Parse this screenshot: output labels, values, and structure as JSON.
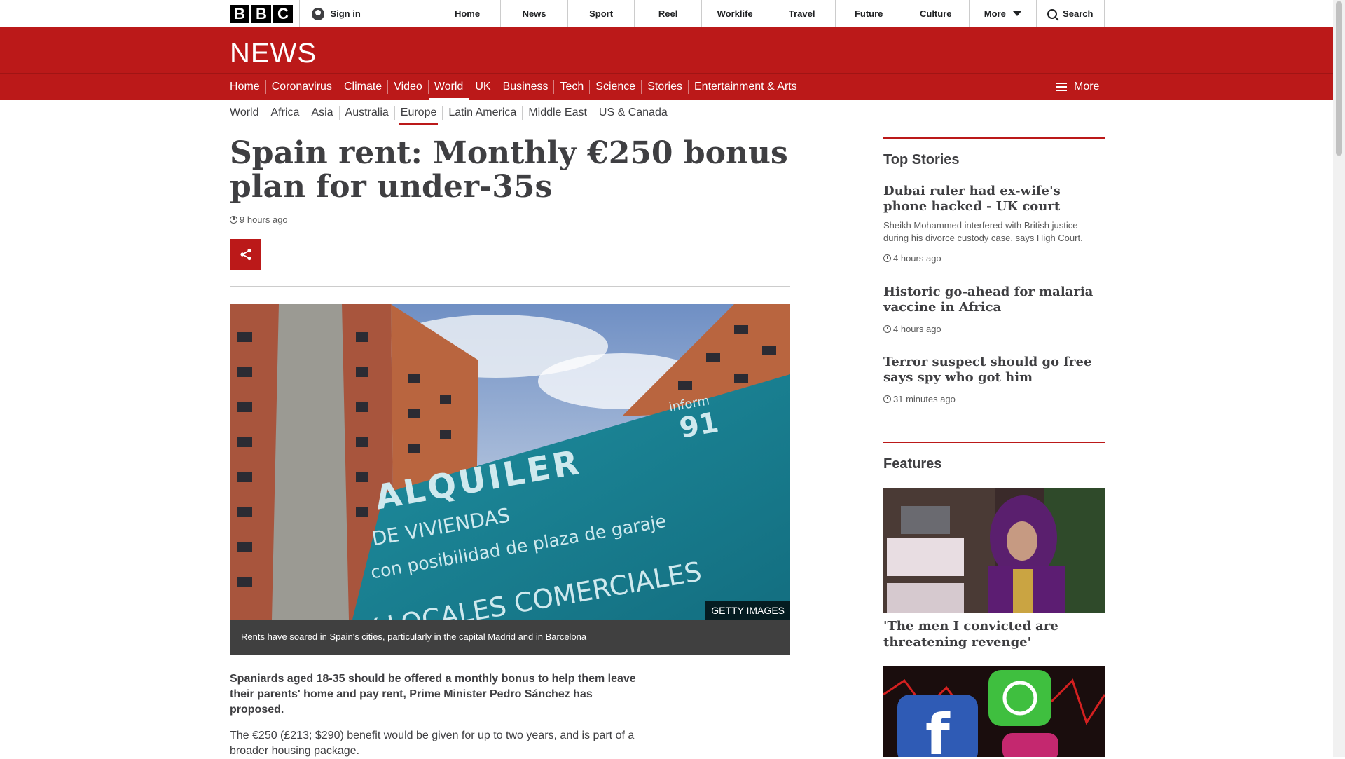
{
  "global_nav": {
    "logo": [
      "B",
      "B",
      "C"
    ],
    "sign_in": "Sign in",
    "items": [
      "Home",
      "News",
      "Sport",
      "Reel",
      "Worklife",
      "Travel",
      "Future",
      "Culture"
    ],
    "more": "More",
    "search": "Search"
  },
  "news_bar": {
    "logo": "NEWS"
  },
  "section_nav": {
    "items": [
      "Home",
      "Coronavirus",
      "Climate",
      "Video",
      "World",
      "UK",
      "Business",
      "Tech",
      "Science",
      "Stories",
      "Entertainment & Arts"
    ],
    "active": "World",
    "more": "More"
  },
  "sub_nav": {
    "items": [
      "World",
      "Africa",
      "Asia",
      "Australia",
      "Europe",
      "Latin America",
      "Middle East",
      "US & Canada"
    ],
    "active": "Europe"
  },
  "article": {
    "title": "Spain rent: Monthly €250 bonus plan for under-35s",
    "time": "9 hours ago",
    "image_credit": "GETTY IMAGES",
    "image_sign": {
      "line1": "ALQUILER",
      "line2": "DE VIVIENDAS",
      "line3": "con posibilidad de plaza de garaje",
      "line4": "Y LOCALES COMERCIALES",
      "corner": "inform",
      "corner_num": "91"
    },
    "caption": "Rents have soared in Spain's cities, particularly in the capital Madrid and in Barcelona",
    "lead": "Spaniards aged 18-35 should be offered a monthly bonus to help them leave their parents' home and pay rent, Prime Minister Pedro Sánchez has proposed.",
    "para": "The €250 (£213; $290) benefit would be given for up to two years, and is part of a broader housing package."
  },
  "sidebar": {
    "top_stories_heading": "Top Stories",
    "stories": [
      {
        "headline": "Dubai ruler had ex-wife's phone hacked - UK court",
        "summary": "Sheikh Mohammed interfered with British justice during his divorce custody case, says High Court.",
        "time": "4 hours ago"
      },
      {
        "headline": "Historic go-ahead for malaria vaccine in Africa",
        "summary": "",
        "time": "4 hours ago"
      },
      {
        "headline": "Terror suspect should go free says spy who got him",
        "summary": "",
        "time": "31 minutes ago"
      }
    ],
    "features_heading": "Features",
    "features": [
      {
        "headline": "'The men I convicted are threatening revenge'"
      }
    ]
  },
  "colors": {
    "brand_red": "#bb1919",
    "text": "#3f3f42"
  }
}
